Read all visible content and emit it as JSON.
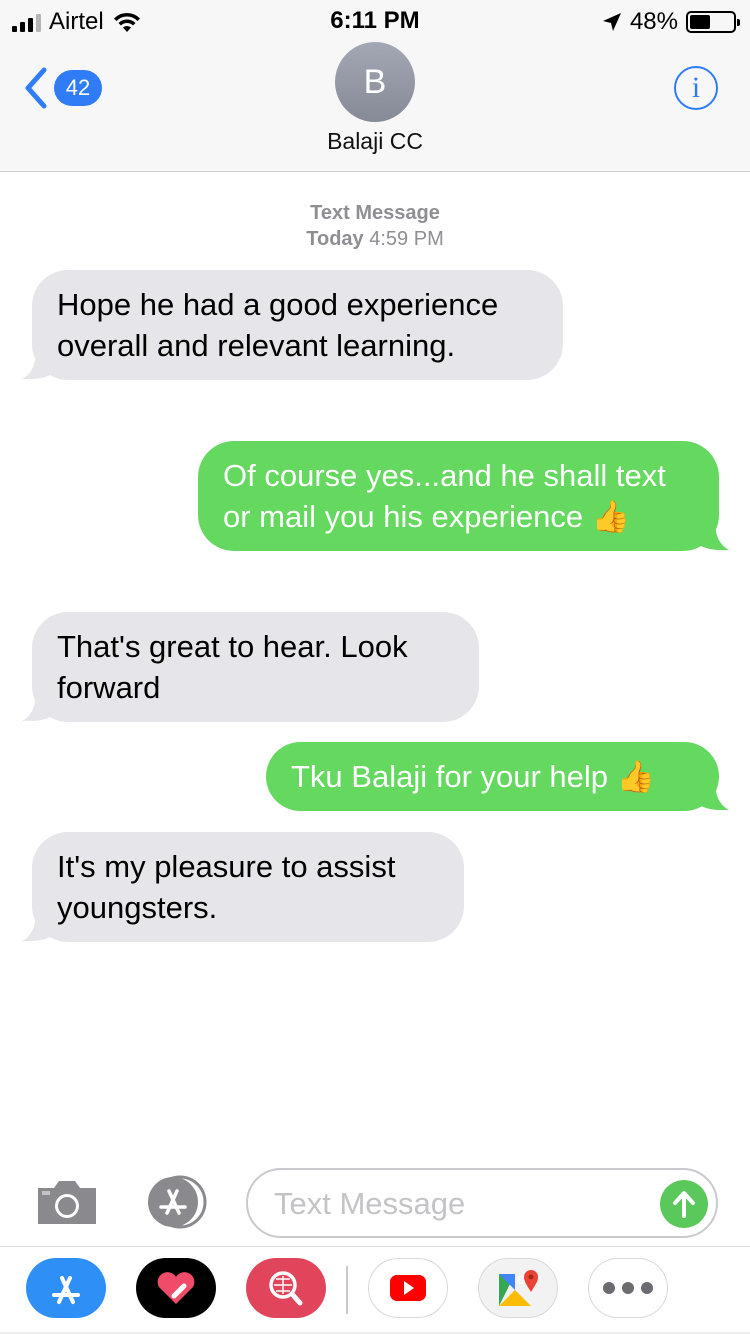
{
  "status_bar": {
    "carrier": "Airtel",
    "time": "6:11 PM",
    "battery_percent": "48%",
    "battery_level": 0.48
  },
  "header": {
    "back_badge": "42",
    "avatar_initial": "B",
    "contact_name": "Balaji CC",
    "info_glyph": "i"
  },
  "conversation": {
    "channel_label": "Text Message",
    "date_label": "Today",
    "time_label": "4:59 PM",
    "messages": [
      {
        "direction": "incoming",
        "text": "Hope he had a good experience overall and relevant learning."
      },
      {
        "direction": "outgoing",
        "text": "Of course yes...and he shall text or mail you his experience 👍"
      },
      {
        "direction": "incoming",
        "text": "That's great to hear. Look forward"
      },
      {
        "direction": "outgoing",
        "text": "Tku Balaji for your help 👍"
      },
      {
        "direction": "incoming",
        "text": "It's my pleasure to assist youngsters."
      }
    ]
  },
  "composer": {
    "placeholder": "Text Message",
    "value": ""
  },
  "app_drawer": {
    "apps": [
      "app-store-icon",
      "digital-touch-icon",
      "search-images-icon",
      "youtube-icon",
      "google-maps-icon",
      "more-apps-icon"
    ]
  },
  "colors": {
    "accent_blue": "#2f7cf6",
    "outgoing_bubble": "#64d85f",
    "incoming_bubble": "#e5e5ea",
    "send_button": "#5bc85b"
  }
}
